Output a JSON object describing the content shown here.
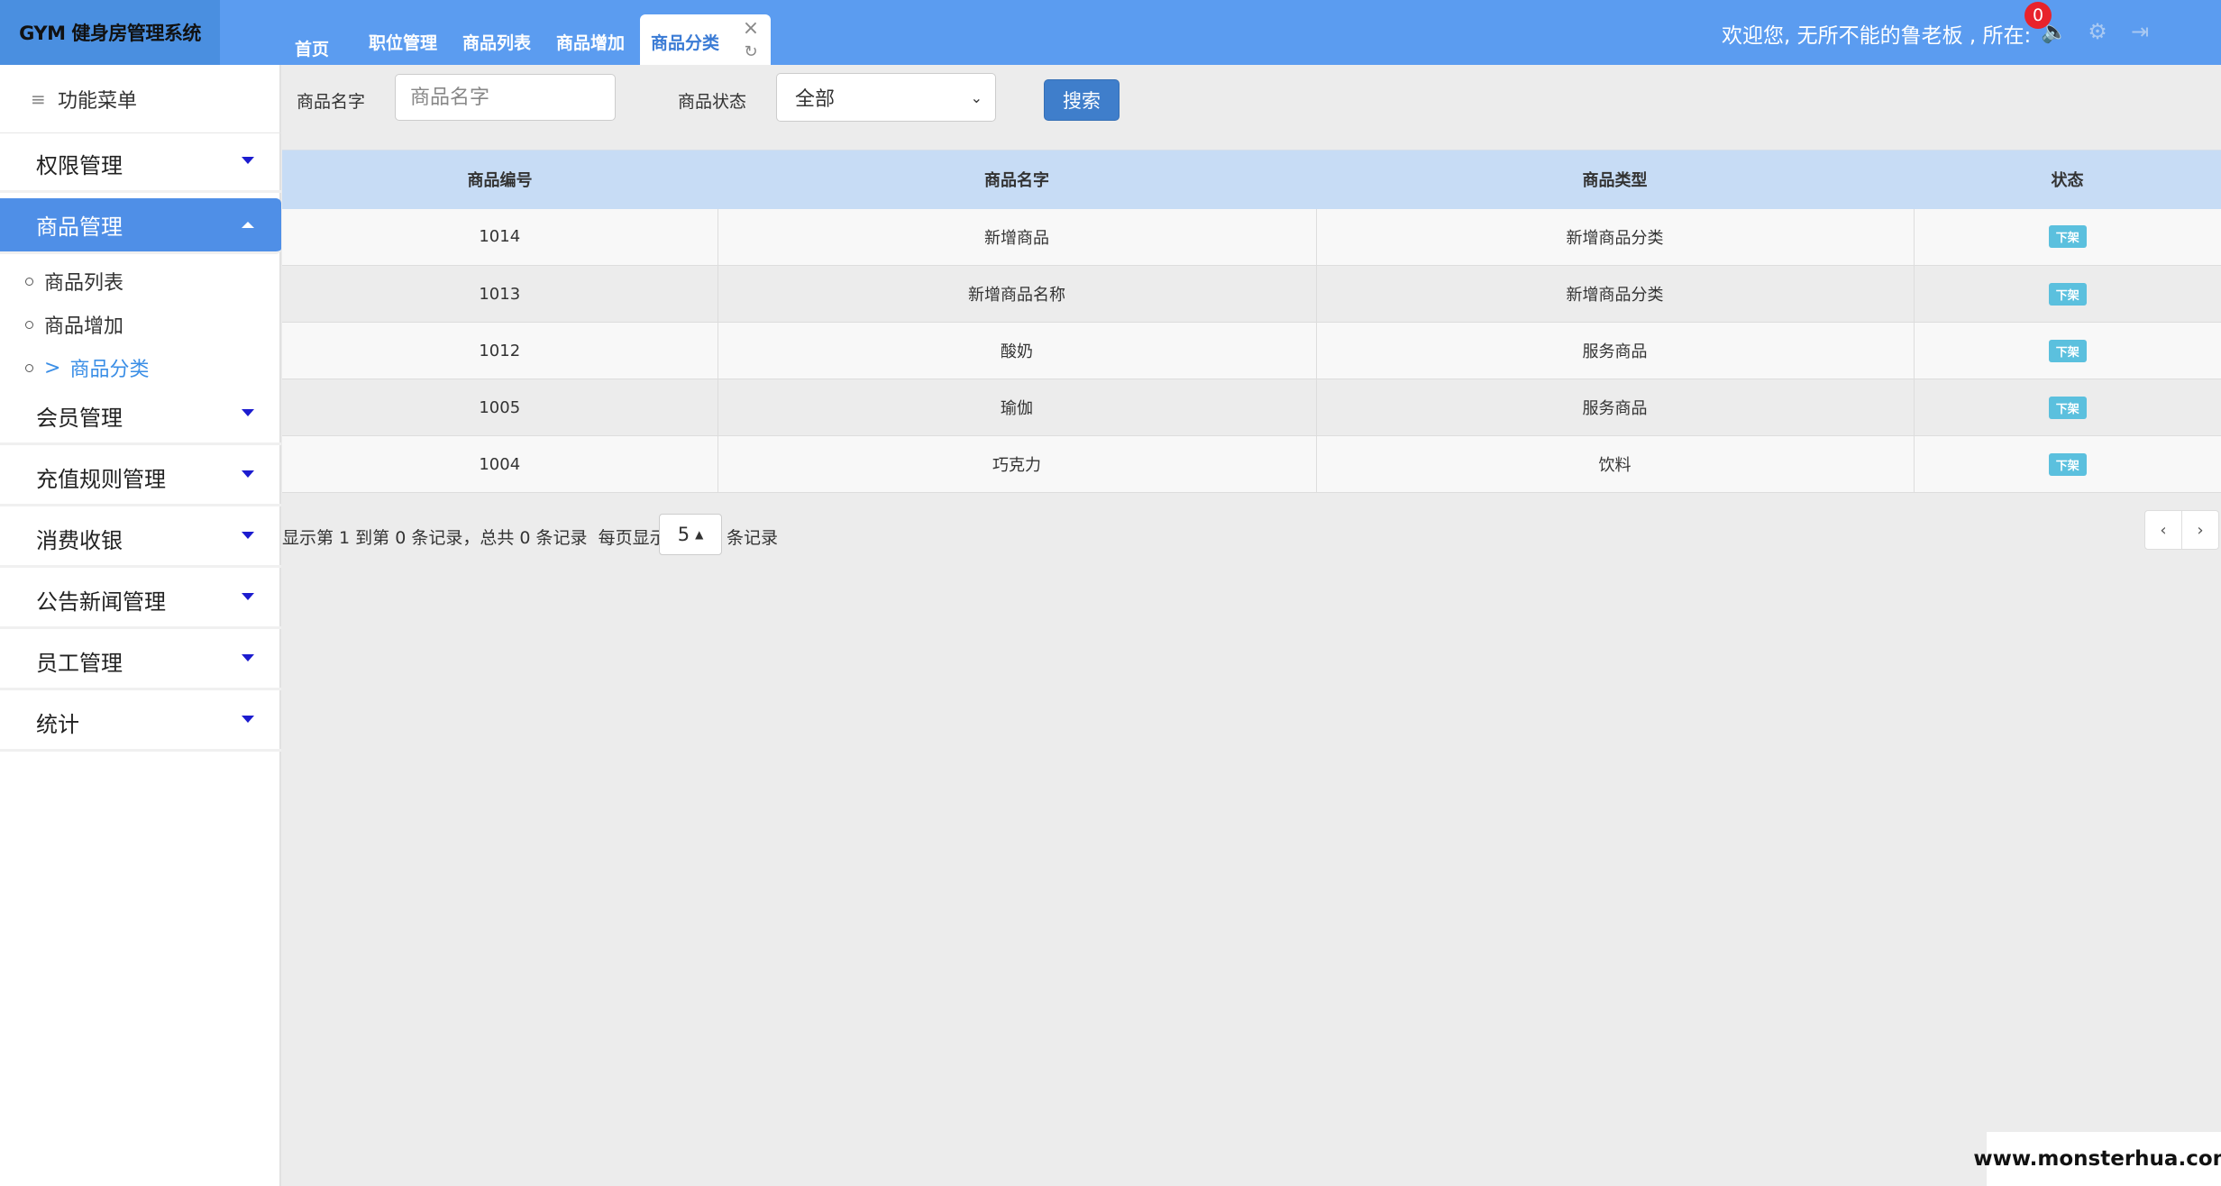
{
  "app": {
    "logo": "GYM 健身房管理系统"
  },
  "tabs": [
    {
      "label": "首页"
    },
    {
      "label": "职位管理"
    },
    {
      "label": "商品列表"
    },
    {
      "label": "商品增加"
    },
    {
      "label": "商品分类"
    }
  ],
  "header": {
    "welcome": "欢迎您, 无所不能的鲁老板 , 所在:",
    "notification_count": "0"
  },
  "icons": {
    "close": "×",
    "refresh": "↻",
    "speaker": "🔈",
    "settings": "⚙",
    "logout": "⇥",
    "hamburger": "≡"
  },
  "sidebar": {
    "header": "功能菜单",
    "items": [
      {
        "label": "权限管理"
      },
      {
        "label": "商品管理"
      },
      {
        "label": "会员管理"
      },
      {
        "label": "充值规则管理"
      },
      {
        "label": "消费收银"
      },
      {
        "label": "公告新闻管理"
      },
      {
        "label": "员工管理"
      },
      {
        "label": "统计"
      }
    ],
    "sub_items": [
      {
        "label": "商品列表"
      },
      {
        "label": "商品增加"
      },
      {
        "label": "商品分类",
        "prefix": ">"
      }
    ]
  },
  "search": {
    "name_label": "商品名字",
    "name_placeholder": "商品名字",
    "status_label": "商品状态",
    "status_selected": "全部",
    "button": "搜索"
  },
  "table": {
    "columns": [
      "商品编号",
      "商品名字",
      "商品类型",
      "状态"
    ],
    "rows": [
      {
        "id": "1014",
        "name": "新增商品",
        "type": "新增商品分类",
        "state": "下架"
      },
      {
        "id": "1013",
        "name": "新增商品名称",
        "type": "新增商品分类",
        "state": "下架"
      },
      {
        "id": "1012",
        "name": "酸奶",
        "type": "服务商品",
        "state": "下架"
      },
      {
        "id": "1005",
        "name": "瑜伽",
        "type": "服务商品",
        "state": "下架"
      },
      {
        "id": "1004",
        "name": "巧克力",
        "type": "饮料",
        "state": "下架"
      }
    ]
  },
  "pagination": {
    "summary": "显示第 1 到第 0 条记录，总共 0 条记录",
    "per_page_label": "每页显示",
    "page_size": "5",
    "records_label": "条记录",
    "prev": "‹",
    "next": "›"
  },
  "watermark": "www.monsterhua.com"
}
